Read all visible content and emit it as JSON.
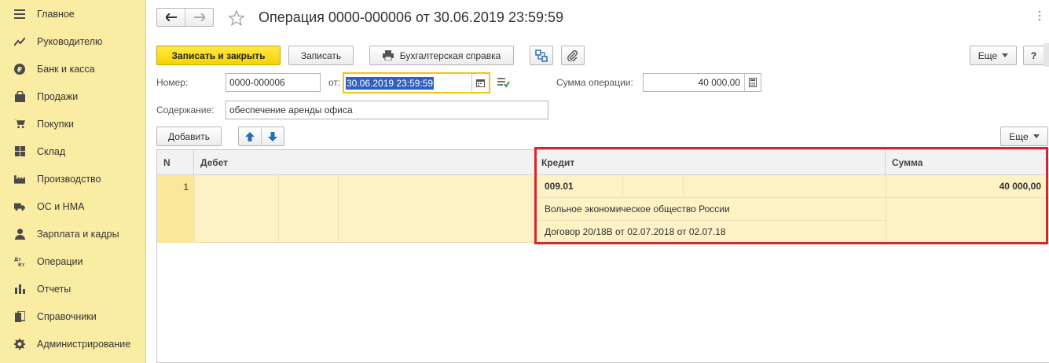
{
  "sidebar": {
    "items": [
      {
        "label": "Главное",
        "icon": "menu-icon"
      },
      {
        "label": "Руководителю",
        "icon": "chart-trend-icon"
      },
      {
        "label": "Банк и касса",
        "icon": "ruble-coin-icon"
      },
      {
        "label": "Продажи",
        "icon": "shopping-bag-icon"
      },
      {
        "label": "Покупки",
        "icon": "cart-icon"
      },
      {
        "label": "Склад",
        "icon": "grid-icon"
      },
      {
        "label": "Производство",
        "icon": "factory-icon"
      },
      {
        "label": "ОС и НМА",
        "icon": "truck-icon"
      },
      {
        "label": "Зарплата и кадры",
        "icon": "person-icon"
      },
      {
        "label": "Операции",
        "icon": "debit-credit-icon"
      },
      {
        "label": "Отчеты",
        "icon": "bar-chart-icon"
      },
      {
        "label": "Справочники",
        "icon": "books-icon"
      },
      {
        "label": "Администрирование",
        "icon": "gear-icon"
      }
    ]
  },
  "header": {
    "title": "Операция 0000-000006 от 30.06.2019 23:59:59"
  },
  "toolbar": {
    "save_close": "Записать и закрыть",
    "save": "Записать",
    "print_reference": "Бухгалтерская справка",
    "more": "Еще",
    "help": "?"
  },
  "form": {
    "number_label": "Номер:",
    "number_value": "0000-000006",
    "date_label": "от:",
    "date_value": "30.06.2019 23:59:59",
    "sum_label": "Сумма операции:",
    "sum_value": "40 000,00",
    "content_label": "Содержание:",
    "content_value": "обеспечение аренды офиса"
  },
  "table_toolbar": {
    "add": "Добавить",
    "more": "Еще"
  },
  "table": {
    "headers": {
      "n": "N",
      "debit": "Дебет",
      "credit": "Кредит",
      "sum": "Сумма"
    },
    "rows": [
      {
        "n": "1",
        "credit_account": "009.01",
        "credit_subconto1": "Вольное экономическое общество России",
        "credit_subconto2": "Договор 20/18В от 02.07.2018 от 02.07.18",
        "sum": "40 000,00"
      }
    ]
  },
  "colors": {
    "sidebar_bg": "#fbeca3",
    "primary_button": "#f6d200",
    "row_selected": "#fdf2c5",
    "highlight": "#d9232d"
  }
}
